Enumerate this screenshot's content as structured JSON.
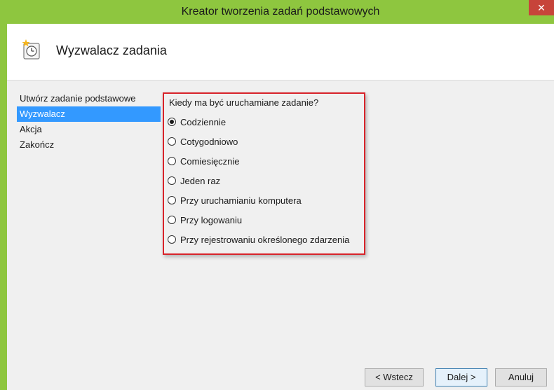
{
  "window": {
    "title": "Kreator tworzenia zadań podstawowych",
    "close_glyph": "✕",
    "accent_color": "#8ec63f"
  },
  "header": {
    "title": "Wyzwalacz zadania",
    "icon": "task-clock-icon"
  },
  "nav": {
    "items": [
      {
        "label": "Utwórz zadanie podstawowe",
        "selected": false
      },
      {
        "label": "Wyzwalacz",
        "selected": true
      },
      {
        "label": "Akcja",
        "selected": false
      },
      {
        "label": "Zakończ",
        "selected": false
      }
    ]
  },
  "trigger": {
    "question": "Kiedy ma być uruchamiane zadanie?",
    "options": [
      {
        "label": "Codziennie",
        "checked": true
      },
      {
        "label": "Cotygodniowo",
        "checked": false
      },
      {
        "label": "Comiesięcznie",
        "checked": false
      },
      {
        "label": "Jeden raz",
        "checked": false
      },
      {
        "label": "Przy uruchamianiu komputera",
        "checked": false
      },
      {
        "label": "Przy logowaniu",
        "checked": false
      },
      {
        "label": "Przy rejestrowaniu określonego zdarzenia",
        "checked": false
      }
    ]
  },
  "buttons": {
    "back": "< Wstecz",
    "next": "Dalej >",
    "cancel": "Anuluj"
  }
}
